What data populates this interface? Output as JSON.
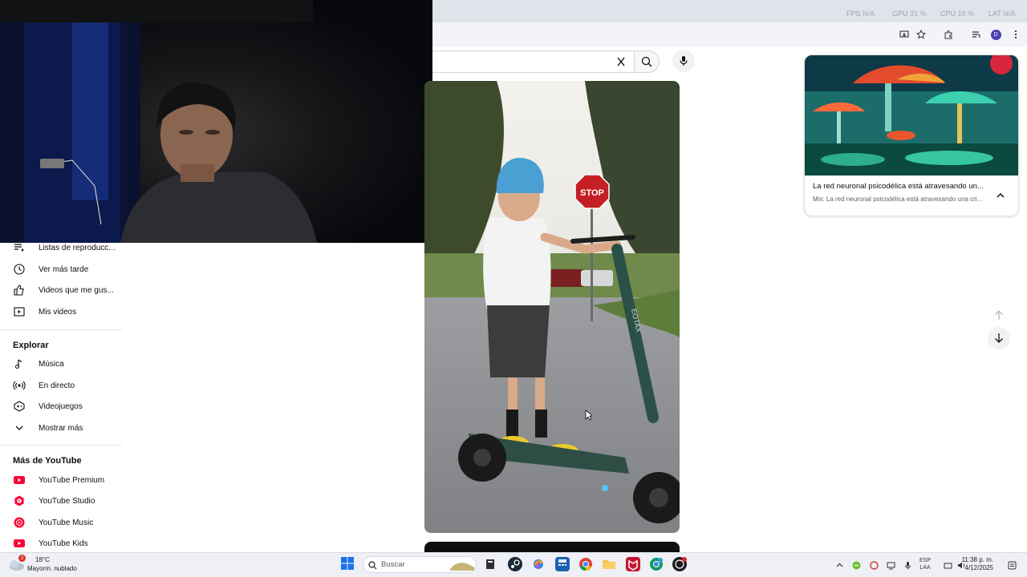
{
  "overlay_stats": {
    "fps_label": "FPS",
    "fps_value": "N/A",
    "gpu_label": "GPU",
    "gpu_value": "31 %",
    "cpu_label": "CPU",
    "cpu_value": "10 %",
    "lat_label": "LAT",
    "lat_value": "N/A"
  },
  "sidebar": {
    "you_items": [
      {
        "label": "Listas de reproducc...",
        "icon": "playlist-icon"
      },
      {
        "label": "Ver más tarde",
        "icon": "clock-icon"
      },
      {
        "label": "Videos que me gus...",
        "icon": "thumbs-up-icon"
      },
      {
        "label": "Mis videos",
        "icon": "my-videos-icon"
      }
    ],
    "explore_title": "Explorar",
    "explore_items": [
      {
        "label": "Música",
        "icon": "music-note-icon"
      },
      {
        "label": "En directo",
        "icon": "live-icon"
      },
      {
        "label": "Videojuegos",
        "icon": "gamepad-icon"
      },
      {
        "label": "Mostrar más",
        "icon": "chevron-down-icon"
      }
    ],
    "more_title": "Más de YouTube",
    "more_items": [
      {
        "label": "YouTube Premium",
        "icon": "youtube-premium-icon"
      },
      {
        "label": "YouTube Studio",
        "icon": "youtube-studio-icon"
      },
      {
        "label": "YouTube Music",
        "icon": "youtube-music-icon"
      },
      {
        "label": "YouTube Kids",
        "icon": "youtube-kids-icon"
      }
    ]
  },
  "short": {
    "stop_sign_text": "STOP",
    "scooter_brand": "EOTAX"
  },
  "mix_card": {
    "title": "La red neuronal psicodélica está atravesando un...",
    "subtitle": "Mix: La red neuronal psicodélica está atravesando una cri..."
  },
  "taskbar": {
    "weather_temp": "18°C",
    "weather_desc": "Mayorm. nublado",
    "weather_badge": "2",
    "search_placeholder": "Buscar",
    "lang_line1": "ESP",
    "lang_line2": "LAA",
    "time": "11:38 p. m.",
    "date": "4/12/2025"
  },
  "colors": {
    "youtube_red": "#ff0033",
    "chrome_bg": "#dfe3ea",
    "taskbar_bg": "#eef0f6"
  }
}
